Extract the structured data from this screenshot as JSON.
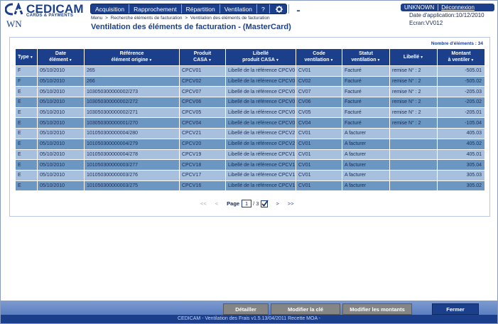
{
  "header": {
    "logo_name": "CEDICAM",
    "logo_sub": "CARDS & PAYMENTS",
    "user_code": "WN",
    "menu": [
      {
        "label": "Acquisition"
      },
      {
        "label": "Rapprochement"
      },
      {
        "label": "Répartition"
      },
      {
        "label": "Ventilation"
      },
      {
        "label": "?"
      },
      {
        "icon": "gear-icon"
      },
      {
        "icon": "printer-icon"
      }
    ],
    "breadcrumb": [
      "Menu",
      ">",
      "Recherche éléments de facturation",
      ">",
      "Ventilation des éléments de facturation"
    ],
    "title": "Ventilation des éléments de facturation - (MasterCard)",
    "user": "UNKNOWN",
    "logout": "Déconnexion",
    "app_date": "Date d'application:10/12/2010",
    "screen": "Ecran:VV012"
  },
  "table": {
    "count_label": "Nombre d'éléments : 34",
    "columns": [
      {
        "l1": "Type",
        "l2": ""
      },
      {
        "l1": "Date",
        "l2": "élément"
      },
      {
        "l1": "Référence",
        "l2": "élément origine"
      },
      {
        "l1": "Produit",
        "l2": "CASA"
      },
      {
        "l1": "Libellé",
        "l2": "produit CASA"
      },
      {
        "l1": "Code",
        "l2": "ventilation"
      },
      {
        "l1": "Statut",
        "l2": "ventilation"
      },
      {
        "l1": "Libellé",
        "l2": ""
      },
      {
        "l1": "Montant",
        "l2": "à ventiler"
      }
    ],
    "rows": [
      [
        "F",
        "05/10/2010",
        "265",
        "CPCV01",
        "Libellé de la référence CPCV0",
        "CV01",
        "Facturé",
        "remise N° : 2",
        "-505.01"
      ],
      [
        "F",
        "05/10/2010",
        "266",
        "CPCV02",
        "Libellé de la référence CPCV0",
        "CV02",
        "Facturé",
        "remise N° : 2",
        "-505.02"
      ],
      [
        "E",
        "05/10/2010",
        "103050300000002/273",
        "CPCV07",
        "Libellé de la référence CPCV0",
        "CV07",
        "Facturé",
        "remise N° : 2",
        "-205.03"
      ],
      [
        "E",
        "05/10/2010",
        "103050300000002/272",
        "CPCV06",
        "Libellé de la référence CPCV0",
        "CV06",
        "Facturé",
        "remise N° : 2",
        "-205.02"
      ],
      [
        "E",
        "05/10/2010",
        "103050300000002/271",
        "CPCV05",
        "Libellé de la référence CPCV0",
        "CV05",
        "Facturé",
        "remise N° : 2",
        "-205.01"
      ],
      [
        "E",
        "05/10/2010",
        "103050300000001/270",
        "CPCV04",
        "Libellé de la référence CPCV0",
        "CV04",
        "Facturé",
        "remise N° : 2",
        "-105.04"
      ],
      [
        "E",
        "05/10/2010",
        "101050300000004/280",
        "CPCV21",
        "Libellé de la référence CPCV2",
        "CV01",
        "A facturer",
        "",
        "405.03"
      ],
      [
        "E",
        "05/10/2010",
        "101050300000004/279",
        "CPCV20",
        "Libellé de la référence CPCV2",
        "CV01",
        "A facturer",
        "",
        "405.02"
      ],
      [
        "E",
        "05/10/2010",
        "101050300000004/278",
        "CPCV19",
        "Libellé de la référence CPCV1",
        "CV01",
        "A facturer",
        "",
        "405.01"
      ],
      [
        "E",
        "05/10/2010",
        "101050300000003/277",
        "CPCV18",
        "Libellé de la référence CPCV1",
        "CV01",
        "A facturer",
        "",
        "305.04"
      ],
      [
        "E",
        "05/10/2010",
        "101050300000003/276",
        "CPCV17",
        "Libellé de la référence CPCV1",
        "CV01",
        "A facturer",
        "",
        "305.03"
      ],
      [
        "E",
        "05/10/2010",
        "101050300000003/275",
        "CPCV16",
        "Libellé de la référence CPCV1",
        "CV01",
        "A facturer",
        "",
        "305.02"
      ]
    ]
  },
  "pager": {
    "first": "<<",
    "prev": "<",
    "label": "Page",
    "current": "1",
    "total": "/ 3",
    "next": ">",
    "last": ">>"
  },
  "footer": {
    "buttons": {
      "detail": "Détailler",
      "modify_key": "Modifier la clé",
      "modify_amounts": "Modifier les montants",
      "close": "Fermer"
    },
    "text": "CEDICAM - Ventilation des Frais v1.5.13/04/2011 Recette MOA -"
  },
  "colors": {
    "brand": "#1c3f8c",
    "row_light": "#a7c0de",
    "row_dark": "#6b97c2"
  }
}
